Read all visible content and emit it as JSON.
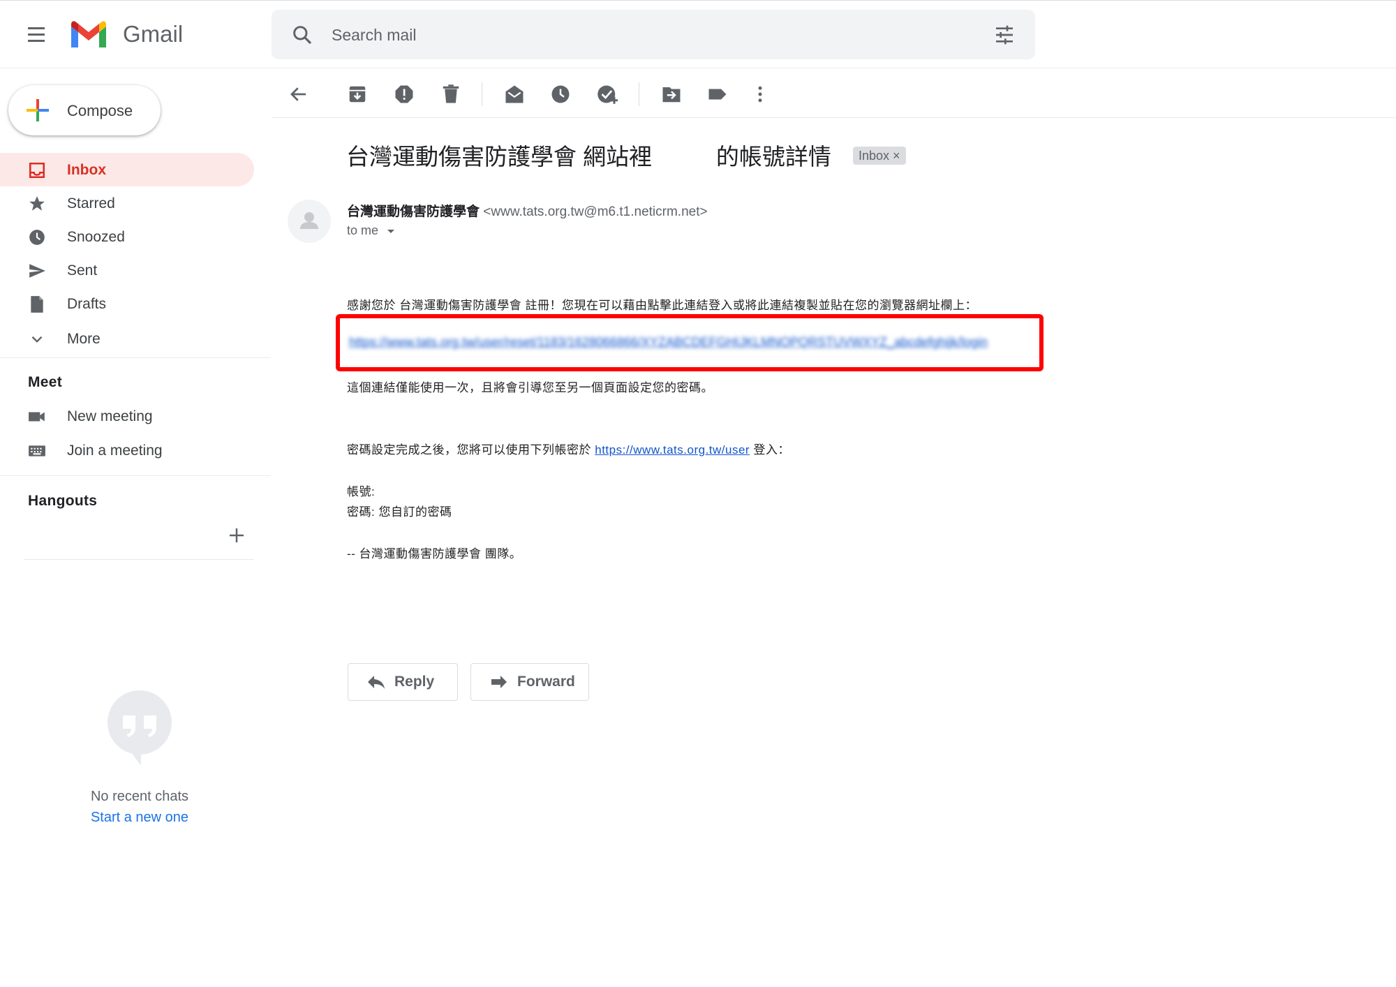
{
  "app": {
    "name": "Gmail"
  },
  "search": {
    "placeholder": "Search mail"
  },
  "compose": {
    "label": "Compose"
  },
  "sidebar": {
    "items": [
      {
        "label": "Inbox",
        "icon": "inbox-icon",
        "active": true
      },
      {
        "label": "Starred",
        "icon": "star-icon"
      },
      {
        "label": "Snoozed",
        "icon": "clock-icon"
      },
      {
        "label": "Sent",
        "icon": "send-icon"
      },
      {
        "label": "Drafts",
        "icon": "draft-icon"
      },
      {
        "label": "More",
        "icon": "chevron-down-icon"
      }
    ],
    "meet": {
      "title": "Meet",
      "items": [
        {
          "label": "New meeting",
          "icon": "video-icon"
        },
        {
          "label": "Join a meeting",
          "icon": "keyboard-icon"
        }
      ]
    },
    "hangouts": {
      "title": "Hangouts",
      "no_chats": "No recent chats",
      "start_new": "Start a new one"
    }
  },
  "toolbar": {
    "icons": [
      "back-icon",
      "archive-icon",
      "report-spam-icon",
      "delete-icon",
      "mark-unread-icon",
      "snooze-icon",
      "add-task-icon",
      "move-to-icon",
      "label-icon",
      "more-vert-icon"
    ]
  },
  "message": {
    "subject": "台灣運動傷害防護學會 網站裡          的帳號詳情",
    "label_chip": "Inbox ×",
    "sender_name": "台灣運動傷害防護學會",
    "sender_email": "<www.tats.org.tw@m6.t1.neticrm.net>",
    "recipient": "to me",
    "body": {
      "line1": "感謝您於 台灣運動傷害防護學會 註冊！您現在可以藉由點擊此連結登入或將此連結複製並貼在您的瀏覽器網址欄上：",
      "line2": "這個連結僅能使用一次，且將會引導您至另一個頁面設定您的密碼。",
      "line3_pre": "密碼設定完成之後，您將可以使用下列帳密於 ",
      "line3_link": "https://www.tats.org.tw/user",
      "line3_post": " 登入：",
      "account_label": "帳號:",
      "password_line": "密碼: 您自訂的密碼",
      "signature": "--  台灣運動傷害防護學會 團隊。"
    }
  },
  "actions": {
    "reply": "Reply",
    "forward": "Forward"
  },
  "colors": {
    "highlight": "#ff0000",
    "link": "#1155cc",
    "active_nav": "#d93025"
  }
}
